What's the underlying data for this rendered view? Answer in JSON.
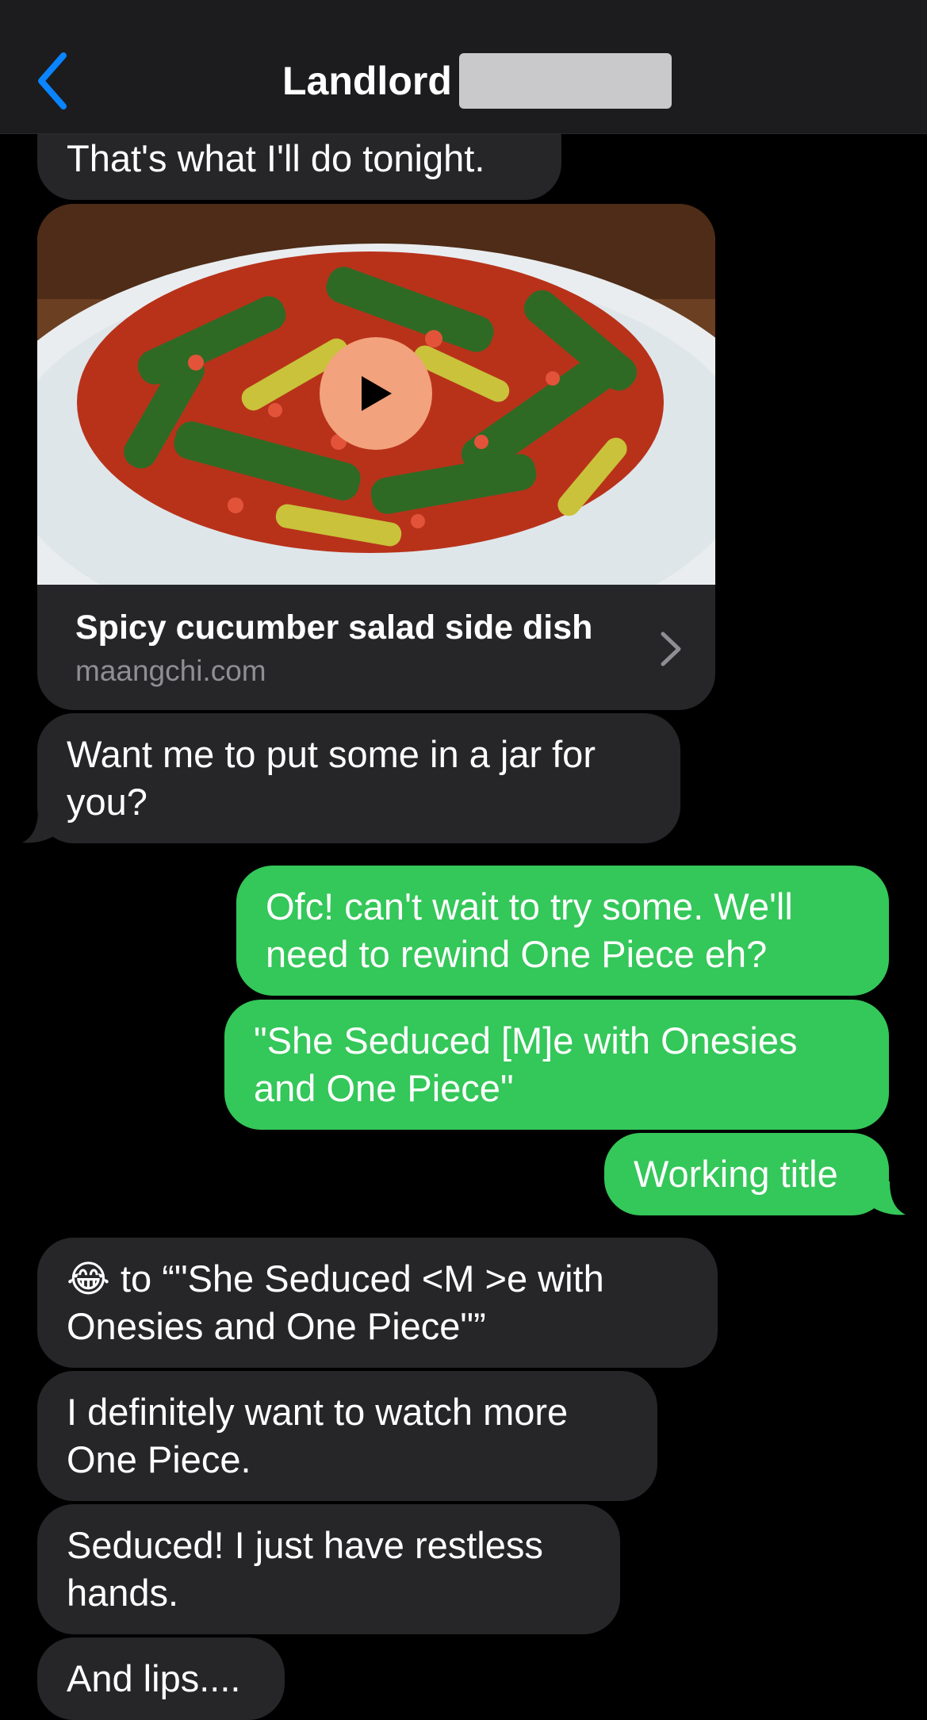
{
  "header": {
    "contact_name": "Landlord",
    "back_icon": "chevron-left-icon"
  },
  "link_preview": {
    "title": "Spicy cucumber salad side dish",
    "domain": "maangchi.com",
    "play_icon": "play-icon",
    "chevron_icon": "chevron-right-icon"
  },
  "messages": [
    {
      "from": "them",
      "text": "That's what I'll do tonight."
    },
    {
      "from": "them",
      "text": "Want me to put some in a jar for\nyou?"
    },
    {
      "from": "me",
      "text": "Ofc! can't wait to try some. We'll\nneed to rewind One Piece eh?"
    },
    {
      "from": "me",
      "text": "\"She Seduced [M]e with Onesies\nand One Piece\""
    },
    {
      "from": "me",
      "text": "Working title"
    },
    {
      "from": "them",
      "emoji": "😂",
      "text": " to “\"She Seduced  <M >e with\nOnesies and One Piece\"”"
    },
    {
      "from": "them",
      "text": "I definitely want to watch more\nOne Piece."
    },
    {
      "from": "them",
      "text": "Seduced! I just have restless\nhands."
    },
    {
      "from": "them",
      "text": "And lips...."
    }
  ],
  "colors": {
    "incoming_bubble": "#262629",
    "outgoing_bubble": "#34c759",
    "accent": "#0a84ff",
    "header_bg": "#1c1c1e"
  }
}
